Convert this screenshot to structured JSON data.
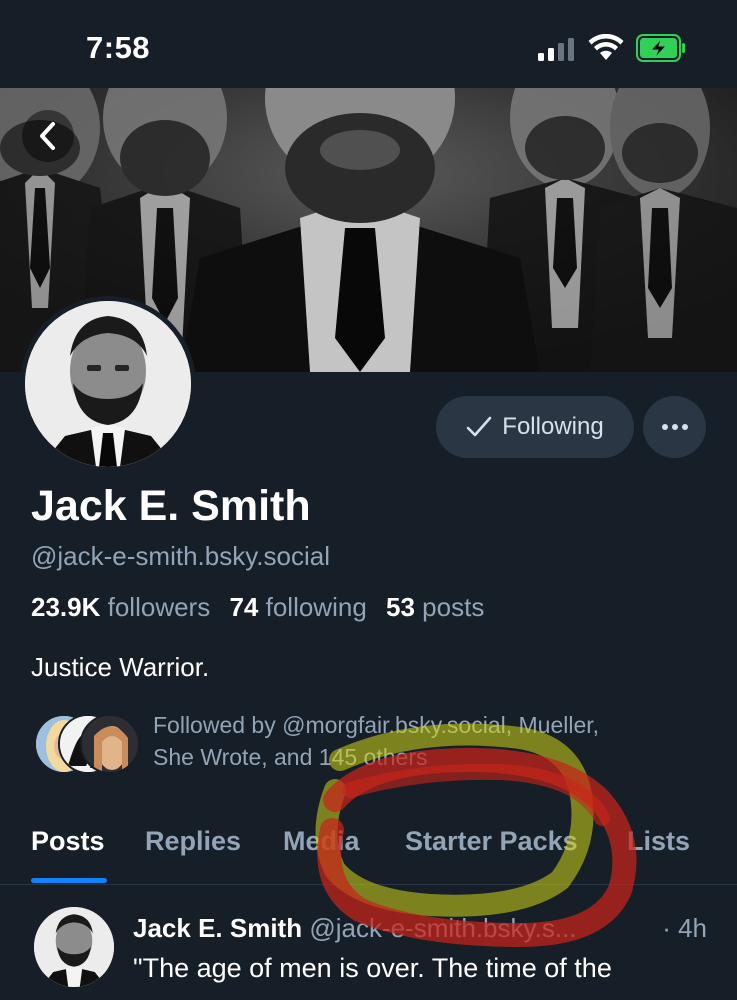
{
  "status_bar": {
    "time": "7:58"
  },
  "profile": {
    "display_name": "Jack E. Smith",
    "handle": "@jack-e-smith.bsky.social",
    "followers_count": "23.9K",
    "followers_label": "followers",
    "following_count": "74",
    "following_label": "following",
    "posts_count": "53",
    "posts_label": "posts",
    "bio": "Justice Warrior.",
    "followed_by_line1": "Followed by @morgfair.bsky.social, Mueller,",
    "followed_by_line2": "She Wrote, and 145 others"
  },
  "actions": {
    "following_label": "Following",
    "more_label": "···"
  },
  "tabs": [
    {
      "label": "Posts",
      "active": true
    },
    {
      "label": "Replies",
      "active": false
    },
    {
      "label": "Media",
      "active": false
    },
    {
      "label": "Starter Packs",
      "active": false
    },
    {
      "label": "Lists",
      "active": false
    }
  ],
  "post": {
    "author": "Jack E. Smith",
    "handle": "@jack-e-smith.bsky.s...",
    "time": "· 4h",
    "text": "\"The age of men is over. The time of the"
  },
  "colors": {
    "background": "#161e27",
    "button_bg": "#2a3644",
    "muted_text": "#93a4b6",
    "accent": "#1183fe",
    "battery": "#31d158",
    "annotation_red": "#c9241b",
    "annotation_yellow": "#d2d616"
  }
}
